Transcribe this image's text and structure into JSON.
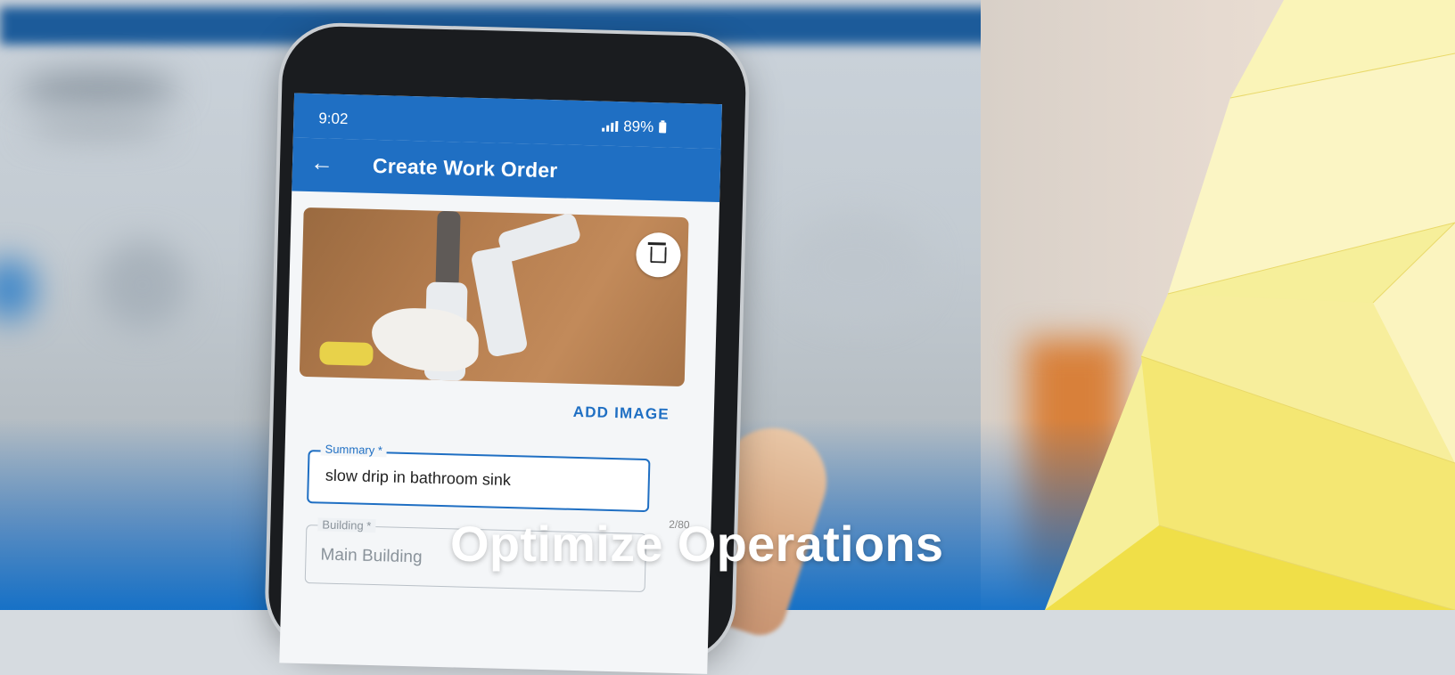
{
  "phone": {
    "status_time": "9:02",
    "status_battery": "89%",
    "appbar_title": "Create Work Order",
    "add_image_label": "ADD IMAGE",
    "summary_label": "Summary *",
    "summary_value": "slow drip in bathroom sink",
    "summary_counter": "2/80",
    "building_label": "Building *",
    "building_value": "Main Building"
  },
  "headline": "Optimize Operations",
  "colors": {
    "app_blue": "#1f6fc3",
    "accent_yellow": "#f2e45a",
    "headline_text": "#ffffff"
  }
}
